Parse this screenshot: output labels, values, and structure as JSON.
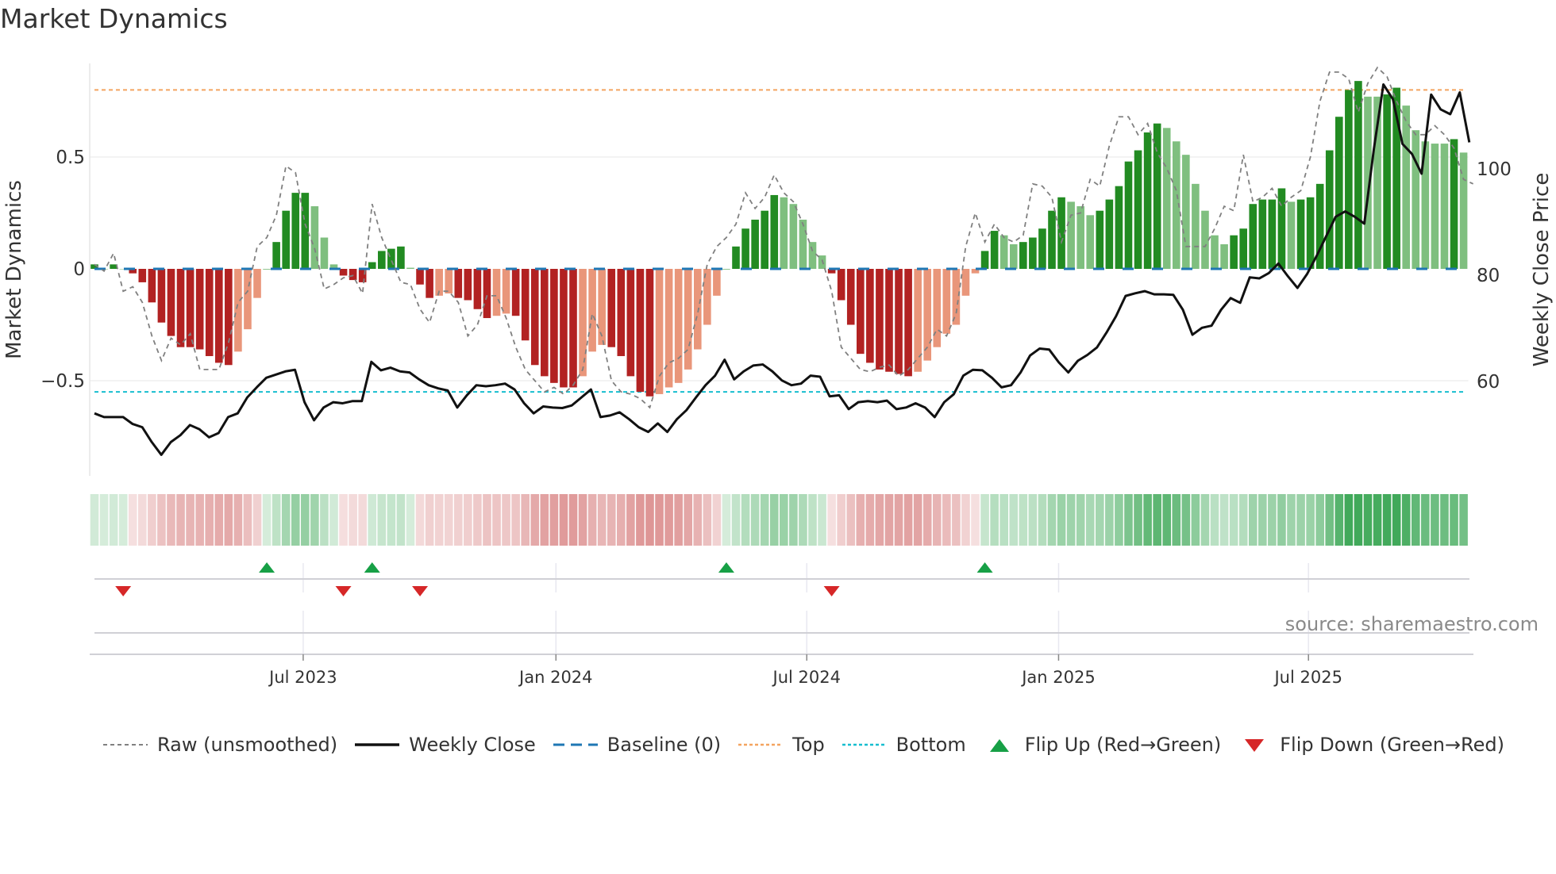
{
  "title": "Market Dynamics",
  "source": "source: sharemaestro.com",
  "chart_data": {
    "type": "bar",
    "title": "Market Dynamics",
    "ylabel": "Market Dynamics",
    "y2label": "Weekly Close Price",
    "ylim": [
      -0.92,
      0.92
    ],
    "y2lim": [
      40,
      124
    ],
    "yticks": [
      {
        "value": 0.5,
        "label": "0.5"
      },
      {
        "value": 0,
        "label": "0"
      },
      {
        "value": -0.5,
        "label": "−0.5"
      }
    ],
    "y2ticks": [
      {
        "value": 100,
        "label": "100"
      },
      {
        "value": 80,
        "label": "80"
      },
      {
        "value": 60,
        "label": "60"
      }
    ],
    "xticks": [
      {
        "week": 21.8,
        "label": "Jul 2023"
      },
      {
        "week": 48.2,
        "label": "Jan 2024"
      },
      {
        "week": 74.4,
        "label": "Jul 2024"
      },
      {
        "week": 100.7,
        "label": "Jan 2025"
      },
      {
        "week": 126.8,
        "label": "Jul 2025"
      }
    ],
    "top_level": 0.8,
    "bottom_level": -0.55,
    "baseline": 0,
    "momentum": [
      0.02,
      0.0,
      0.02,
      0.0,
      -0.02,
      -0.06,
      -0.15,
      -0.24,
      -0.3,
      -0.35,
      -0.35,
      -0.36,
      -0.39,
      -0.42,
      -0.43,
      -0.37,
      -0.27,
      -0.13,
      0.0,
      0.12,
      0.26,
      0.34,
      0.34,
      0.28,
      0.14,
      0.02,
      -0.03,
      -0.05,
      -0.06,
      0.03,
      0.08,
      0.09,
      0.1,
      0.005,
      -0.07,
      -0.13,
      -0.12,
      -0.11,
      -0.13,
      -0.14,
      -0.18,
      -0.22,
      -0.21,
      -0.2,
      -0.21,
      -0.32,
      -0.43,
      -0.48,
      -0.51,
      -0.53,
      -0.53,
      -0.48,
      -0.37,
      -0.34,
      -0.35,
      -0.39,
      -0.48,
      -0.55,
      -0.57,
      -0.56,
      -0.53,
      -0.51,
      -0.45,
      -0.36,
      -0.25,
      -0.12,
      0.0,
      0.1,
      0.18,
      0.22,
      0.26,
      0.33,
      0.32,
      0.29,
      0.22,
      0.12,
      0.06,
      -0.02,
      -0.14,
      -0.25,
      -0.38,
      -0.42,
      -0.45,
      -0.46,
      -0.47,
      -0.48,
      -0.46,
      -0.41,
      -0.35,
      -0.29,
      -0.25,
      -0.12,
      -0.02,
      0.08,
      0.17,
      0.15,
      0.11,
      0.12,
      0.14,
      0.18,
      0.26,
      0.32,
      0.3,
      0.28,
      0.24,
      0.26,
      0.31,
      0.37,
      0.48,
      0.53,
      0.61,
      0.65,
      0.63,
      0.57,
      0.51,
      0.38,
      0.26,
      0.15,
      0.11,
      0.15,
      0.18,
      0.29,
      0.31,
      0.31,
      0.36,
      0.3,
      0.31,
      0.32,
      0.38,
      0.53,
      0.68,
      0.8,
      0.84,
      0.77,
      0.77,
      0.78,
      0.81,
      0.73,
      0.62,
      0.57,
      0.56,
      0.56,
      0.58,
      0.52
    ],
    "raw": [
      0.02,
      -0.01,
      0.07,
      -0.1,
      -0.08,
      -0.15,
      -0.3,
      -0.41,
      -0.31,
      -0.34,
      -0.29,
      -0.45,
      -0.45,
      -0.45,
      -0.33,
      -0.15,
      -0.1,
      0.1,
      0.14,
      0.24,
      0.46,
      0.43,
      0.2,
      0.09,
      -0.09,
      -0.07,
      -0.04,
      -0.03,
      -0.11,
      0.29,
      0.14,
      0.04,
      -0.06,
      -0.07,
      -0.18,
      -0.24,
      -0.1,
      -0.1,
      -0.15,
      -0.3,
      -0.25,
      -0.12,
      -0.12,
      -0.22,
      -0.35,
      -0.45,
      -0.5,
      -0.55,
      -0.53,
      -0.56,
      -0.52,
      -0.45,
      -0.2,
      -0.3,
      -0.5,
      -0.55,
      -0.56,
      -0.58,
      -0.62,
      -0.48,
      -0.42,
      -0.4,
      -0.36,
      -0.2,
      0.02,
      0.1,
      0.14,
      0.2,
      0.34,
      0.27,
      0.32,
      0.42,
      0.34,
      0.3,
      0.2,
      0.08,
      0.04,
      -0.1,
      -0.35,
      -0.4,
      -0.45,
      -0.46,
      -0.44,
      -0.43,
      -0.48,
      -0.45,
      -0.4,
      -0.35,
      -0.27,
      -0.3,
      -0.2,
      0.1,
      0.25,
      0.12,
      0.2,
      0.14,
      0.12,
      0.15,
      0.38,
      0.37,
      0.32,
      0.12,
      0.24,
      0.25,
      0.4,
      0.37,
      0.55,
      0.68,
      0.68,
      0.6,
      0.65,
      0.52,
      0.45,
      0.35,
      0.1,
      0.1,
      0.1,
      0.18,
      0.28,
      0.26,
      0.51,
      0.3,
      0.32,
      0.36,
      0.28,
      0.32,
      0.35,
      0.5,
      0.75,
      0.88,
      0.88,
      0.85,
      0.7,
      0.83,
      0.9,
      0.86,
      0.75,
      0.66,
      0.6,
      0.6,
      0.64,
      0.6,
      0.54,
      0.4,
      0.38
    ],
    "close": [
      54.0,
      53.3,
      53.3,
      53.3,
      52.0,
      51.4,
      48.6,
      46.2,
      48.6,
      49.9,
      51.8,
      51.0,
      49.5,
      50.3,
      53.3,
      54.0,
      57.0,
      58.9,
      60.7,
      61.3,
      61.9,
      62.2,
      56.1,
      52.7,
      55.1,
      56.1,
      55.9,
      56.3,
      56.3,
      63.7,
      62.1,
      62.6,
      61.9,
      61.7,
      60.4,
      59.3,
      58.7,
      58.3,
      55.1,
      57.4,
      59.3,
      59.1,
      59.3,
      59.6,
      58.5,
      55.9,
      54.0,
      55.3,
      55.1,
      55.0,
      55.5,
      57.0,
      58.5,
      53.3,
      53.6,
      54.2,
      52.9,
      51.4,
      50.5,
      52.1,
      50.5,
      52.9,
      54.6,
      57.0,
      59.3,
      61.1,
      64.1,
      60.4,
      61.9,
      63.0,
      63.2,
      61.9,
      60.2,
      59.3,
      59.6,
      61.1,
      60.9,
      57.2,
      57.4,
      54.8,
      56.1,
      56.3,
      56.1,
      56.4,
      54.8,
      55.1,
      55.9,
      55.1,
      53.3,
      56.1,
      57.6,
      61.1,
      62.2,
      62.1,
      60.7,
      58.9,
      59.3,
      61.7,
      64.9,
      66.2,
      66.0,
      63.6,
      61.7,
      63.9,
      65.0,
      66.4,
      69.2,
      72.3,
      76.1,
      76.6,
      77.0,
      76.4,
      76.4,
      76.3,
      73.5,
      68.8,
      70.1,
      70.5,
      73.5,
      75.7,
      74.8,
      79.6,
      79.4,
      80.4,
      82.2,
      79.8,
      77.6,
      80.2,
      83.6,
      87.3,
      91.0,
      92.0,
      91.0,
      89.7,
      103.7,
      115.9,
      113.1,
      104.7,
      102.8,
      99.1,
      114.0,
      111.2,
      110.3,
      114.4,
      105.0
    ],
    "flip_up_weeks": [
      18,
      29,
      66,
      93
    ],
    "flip_down_weeks": [
      3,
      26,
      34,
      77
    ],
    "legend": {
      "raw": "Raw (unsmoothed)",
      "close": "Weekly Close",
      "baseline": "Baseline (0)",
      "top": "Top",
      "bottom": "Bottom",
      "flip_up": "Flip Up (Red→Green)",
      "flip_down": "Flip Down (Green→Red)"
    },
    "legend_position": "bottom",
    "colors": {
      "green_dark": "#228b22",
      "green_light": "#7fbf7f",
      "red_dark": "#b22222",
      "red_light": "#e9967a",
      "raw": "#808080",
      "close": "#111111",
      "baseline": "#1f77b4",
      "top": "#f4a460",
      "bottom": "#17becf",
      "flip_up": "#17a046",
      "flip_down": "#d62728"
    }
  }
}
